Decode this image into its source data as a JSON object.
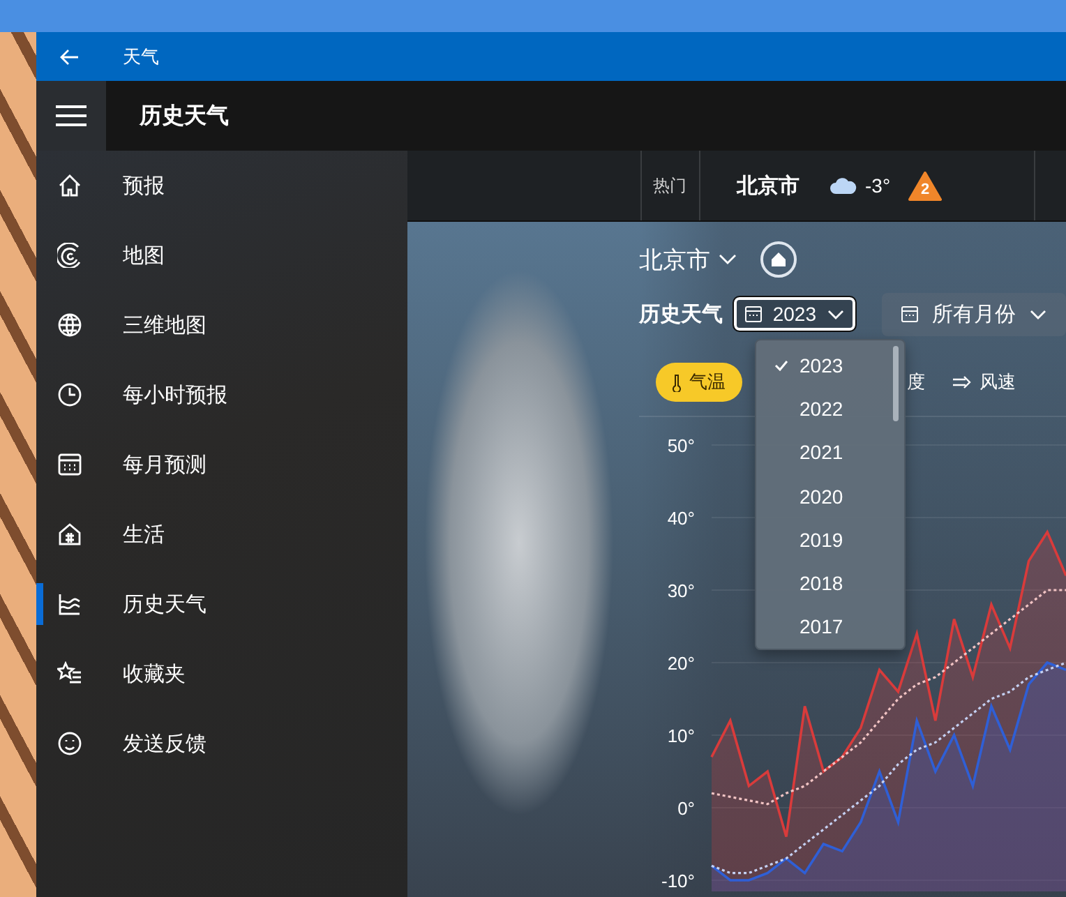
{
  "window": {
    "title": "天气"
  },
  "header": {
    "title": "历史天气"
  },
  "sidebar": {
    "items": [
      {
        "label": "预报",
        "selected": false
      },
      {
        "label": "地图",
        "selected": false
      },
      {
        "label": "三维地图",
        "selected": false
      },
      {
        "label": "每小时预报",
        "selected": false
      },
      {
        "label": "每月预测",
        "selected": false
      },
      {
        "label": "生活",
        "selected": false
      },
      {
        "label": "历史天气",
        "selected": true
      },
      {
        "label": "收藏夹",
        "selected": false
      },
      {
        "label": "发送反馈",
        "selected": false
      }
    ]
  },
  "top_bar": {
    "section_label": "热门",
    "city": "北京市",
    "temperature": "-3°",
    "alert_count": "2"
  },
  "panel": {
    "location": "北京市",
    "title": "历史天气",
    "year_dropdown": {
      "value": "2023"
    },
    "month_dropdown": {
      "value": "所有月份"
    },
    "metric_tabs": [
      {
        "label": "气温",
        "selected": true
      },
      {
        "label": "度",
        "selected": false
      },
      {
        "label": "风速",
        "selected": false
      }
    ],
    "year_menu": {
      "items": [
        {
          "label": "2023",
          "selected": true
        },
        {
          "label": "2022",
          "selected": false
        },
        {
          "label": "2021",
          "selected": false
        },
        {
          "label": "2020",
          "selected": false
        },
        {
          "label": "2019",
          "selected": false
        },
        {
          "label": "2018",
          "selected": false
        },
        {
          "label": "2017",
          "selected": false
        }
      ]
    },
    "chart_data": {
      "type": "area",
      "grid": true,
      "ylim": [
        -10,
        50
      ],
      "yticks": [
        {
          "value": 50,
          "label": "50°"
        },
        {
          "value": 40,
          "label": "40°"
        },
        {
          "value": 30,
          "label": "30°"
        },
        {
          "value": 20,
          "label": "20°"
        },
        {
          "value": 10,
          "label": "10°"
        },
        {
          "value": 0,
          "label": "0°"
        },
        {
          "value": -10,
          "label": "-10°"
        }
      ],
      "series": [
        {
          "color": "#d93b3b",
          "line_style": "solid",
          "values": [
            7,
            12,
            3,
            5,
            -4,
            14,
            5,
            7,
            11,
            19,
            16,
            24,
            12,
            26,
            18,
            28,
            22,
            34,
            38,
            32
          ]
        },
        {
          "color": "#2f5fd6",
          "line_style": "solid",
          "values": [
            -8,
            -10,
            -10,
            -9,
            -7,
            -9,
            -5,
            -6,
            -2,
            5,
            -2,
            12,
            5,
            10,
            3,
            14,
            8,
            17,
            20,
            19
          ]
        },
        {
          "color": "#f2c4c4",
          "type": "line",
          "line_style": "dotted",
          "values": [
            2,
            1.5,
            1,
            0.5,
            2,
            3,
            5,
            7,
            9,
            12,
            15,
            17,
            18,
            20,
            22,
            24,
            26,
            28,
            30,
            30
          ]
        },
        {
          "color": "#c4d0f2",
          "type": "line",
          "line_style": "dotted",
          "values": [
            -8,
            -9,
            -9,
            -8,
            -7,
            -5,
            -3,
            -1,
            1,
            3,
            6,
            8,
            9,
            11,
            13,
            15,
            16,
            18,
            19,
            20
          ]
        }
      ]
    }
  }
}
